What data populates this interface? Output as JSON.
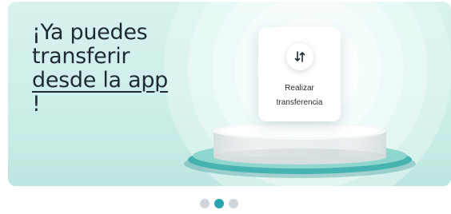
{
  "banner": {
    "headline_line1": "¡Ya puedes",
    "headline_line2": "transferir",
    "headline_line3_link": "desde la app",
    "headline_line3_suffix": "!",
    "card": {
      "icon": "transfer-arrows-icon",
      "label_line1": "Realizar",
      "label_line2": "transferencia"
    }
  },
  "carousel": {
    "slide_count": 3,
    "active_index": 1
  },
  "colors": {
    "banner_background": "#d8f2ef",
    "podium_accent": "#3aa7a8",
    "active_dot": "#2aa3b3",
    "inactive_dot": "#cfd5da"
  }
}
